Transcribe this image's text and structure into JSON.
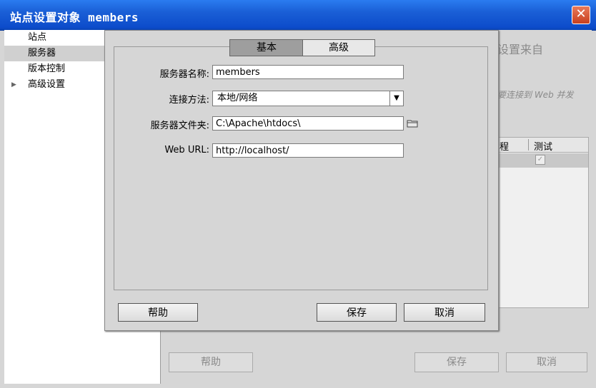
{
  "window": {
    "title": "站点设置对象 members",
    "close_icon": "close-icon"
  },
  "sidebar": {
    "items": [
      {
        "label": "站点",
        "selected": false
      },
      {
        "label": "服务器",
        "selected": true
      },
      {
        "label": "版本控制",
        "selected": false
      },
      {
        "label": "高级设置",
        "selected": false,
        "expandable": true
      }
    ]
  },
  "background": {
    "text1": "设置来自",
    "text2": "要连接到 Web 并发",
    "table": {
      "headers": [
        "程",
        "测试"
      ]
    },
    "buttons": {
      "help": "帮助",
      "save": "保存",
      "cancel": "取消"
    }
  },
  "dialog": {
    "tabs": [
      {
        "label": "基本",
        "active": true
      },
      {
        "label": "高级",
        "active": false
      }
    ],
    "fields": {
      "server_name": {
        "label": "服务器名称:",
        "value": "members"
      },
      "connect_method": {
        "label": "连接方法:",
        "value": "本地/网络"
      },
      "server_folder": {
        "label": "服务器文件夹:",
        "value": "C:\\Apache\\htdocs\\"
      },
      "web_url": {
        "label": "Web URL:",
        "value": "http://localhost/"
      }
    },
    "buttons": {
      "help": "帮助",
      "save": "保存",
      "cancel": "取消"
    }
  }
}
